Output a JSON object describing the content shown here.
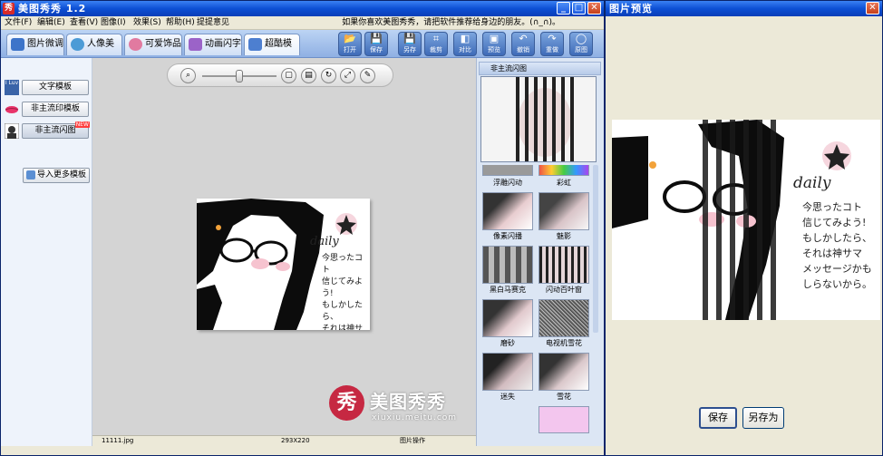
{
  "main_window": {
    "title": "美图秀秀 1.2",
    "app_icon_char": "秀",
    "controls": {
      "minimize": "_",
      "maximize": "□",
      "close": "✕"
    },
    "menu": [
      "文件(F)",
      "编辑(E)",
      "查看(V)",
      "图像(I)",
      "效果(S)",
      "帮助(H)",
      "提提意见"
    ],
    "promo_text": "如果你喜欢美图秀秀，请把软件推荐给身边的朋友。(∩_∩)。"
  },
  "tabs": [
    {
      "label": "图片微调",
      "icon": "adjust-icon",
      "color": "#3d74c9"
    },
    {
      "label": "人像美容",
      "icon": "portrait-icon",
      "color": "#4c9bd6"
    },
    {
      "label": "可爱饰品",
      "icon": "flower-icon",
      "color": "#e17aa0"
    },
    {
      "label": "动画闪字",
      "icon": "text-icon",
      "color": "#9b63c8"
    },
    {
      "label": "超酷模板",
      "icon": "template-icon",
      "color": "#4d7fd0"
    }
  ],
  "tools": [
    {
      "label": "打开",
      "icon": "open-folder-icon",
      "glyph": "📂"
    },
    {
      "label": "保存",
      "icon": "save-icon",
      "glyph": "💾"
    },
    {
      "label": "另存",
      "icon": "save-as-icon",
      "glyph": "💾"
    },
    {
      "label": "裁剪",
      "icon": "crop-icon",
      "glyph": "⌗"
    },
    {
      "label": "对比",
      "icon": "compare-icon",
      "glyph": "◧"
    },
    {
      "label": "预览",
      "icon": "preview-icon",
      "glyph": "▣"
    },
    {
      "label": "撤销",
      "icon": "undo-icon",
      "glyph": "↶"
    },
    {
      "label": "重做",
      "icon": "redo-icon",
      "glyph": "↷"
    },
    {
      "label": "原图",
      "icon": "original-icon",
      "glyph": "◯"
    }
  ],
  "left_panel": {
    "items": [
      {
        "label": "文字模板",
        "icon": "text-template-icon",
        "icon_text": "I Luv"
      },
      {
        "label": "非主流印模板",
        "icon": "lips-icon",
        "icon_text": ""
      },
      {
        "label": "非主流闪图",
        "icon": "face-icon",
        "icon_text": "",
        "badge": "NEW"
      }
    ],
    "import_button": "导入更多模板"
  },
  "zoom": {
    "level": 0.5
  },
  "photo": {
    "doodle_word": "daily",
    "caption_lines": [
      "今思ったコト",
      "信じてみよう!",
      "もしかしたら、",
      "それは神サマ",
      "メッセージかも",
      "しらないから。"
    ]
  },
  "status": {
    "filename": "11111.jpg",
    "dimensions": "293X220",
    "mode": "图片操作"
  },
  "right_panel": {
    "header": "非主流闪图",
    "thumbnails": [
      {
        "label": "浮雕闪动",
        "style": "emboss"
      },
      {
        "label": "彩虹",
        "style": "rainbow"
      },
      {
        "label": "像素闪播",
        "style": "pixel"
      },
      {
        "label": "魅影",
        "style": "ghost"
      },
      {
        "label": "黑白马赛克",
        "style": "bw-mosaic"
      },
      {
        "label": "闪动百叶窗",
        "style": "blinds"
      },
      {
        "label": "磨砂",
        "style": "frosted"
      },
      {
        "label": "电视机雪花",
        "style": "tv-snow"
      },
      {
        "label": "迷失",
        "style": "lost"
      },
      {
        "label": "雪花",
        "style": "snow"
      }
    ]
  },
  "watermark": {
    "title": "美图秀秀",
    "subtitle": "xiuxiu.meitu.com",
    "logo_char": "秀"
  },
  "preview_window": {
    "title": "图片预览",
    "save_button": "保存",
    "save_as_button": "另存为",
    "close": "✕"
  }
}
